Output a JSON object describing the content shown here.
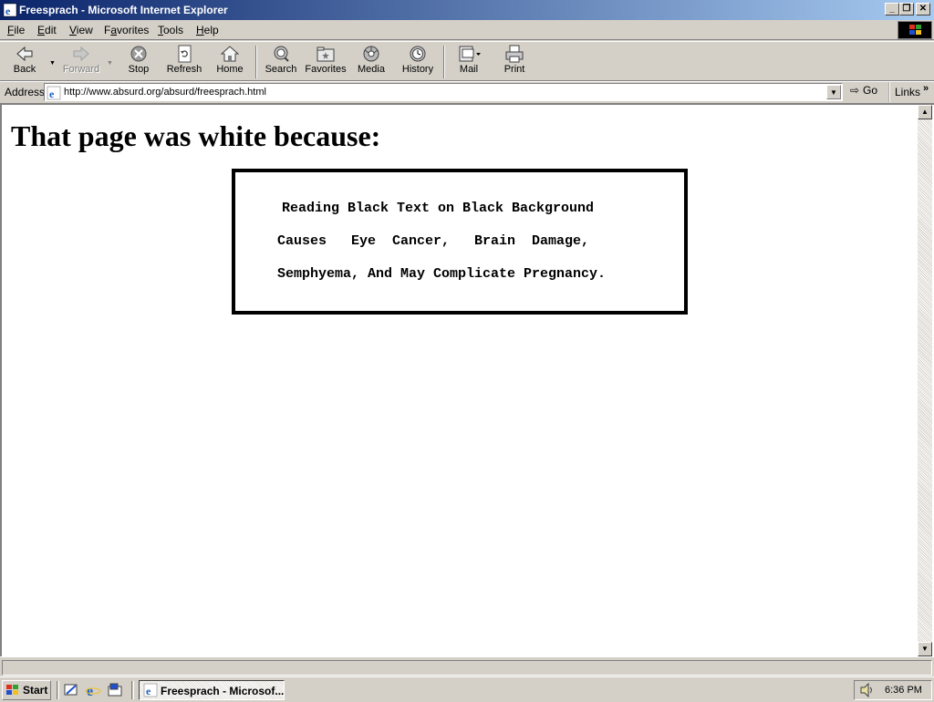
{
  "window": {
    "title": "Freesprach - Microsoft Internet Explorer",
    "minimize_label": "_",
    "maximize_label": "❐",
    "close_label": "✕"
  },
  "menu": {
    "items": [
      {
        "label": "File",
        "accel": "F",
        "rest": "ile"
      },
      {
        "label": "Edit",
        "accel": "E",
        "rest": "dit"
      },
      {
        "label": "View",
        "accel": "V",
        "rest": "iew"
      },
      {
        "label": "Favorites",
        "accel": "a",
        "pre": "F",
        "rest": "vorites"
      },
      {
        "label": "Tools",
        "accel": "T",
        "rest": "ools"
      },
      {
        "label": "Help",
        "accel": "H",
        "rest": "elp"
      }
    ]
  },
  "toolbar": {
    "back": "Back",
    "forward": "Forward",
    "stop": "Stop",
    "refresh": "Refresh",
    "home": "Home",
    "search": "Search",
    "favorites": "Favorites",
    "media": "Media",
    "history": "History",
    "mail": "Mail",
    "print": "Print"
  },
  "address": {
    "label": "Address",
    "url": "http://www.absurd.org/absurd/freesprach.html",
    "go": "Go",
    "links": "Links",
    "links_chevron": "»"
  },
  "page": {
    "heading": "That page was white because:",
    "warning_lines": [
      "Reading Black Text on Black Background",
      "Causes   Eye  Cancer,   Brain  Damage,",
      "Semphyema, And May Complicate Pregnancy."
    ]
  },
  "taskbar": {
    "start": "Start",
    "task_label": "Freesprach - Microsof...",
    "clock": "6:36 PM"
  },
  "colors": {
    "titlebar_start": "#0a246a",
    "titlebar_end": "#a6caf0",
    "chrome": "#d4d0c8",
    "page_background": "#ffffff",
    "text": "#000000"
  }
}
